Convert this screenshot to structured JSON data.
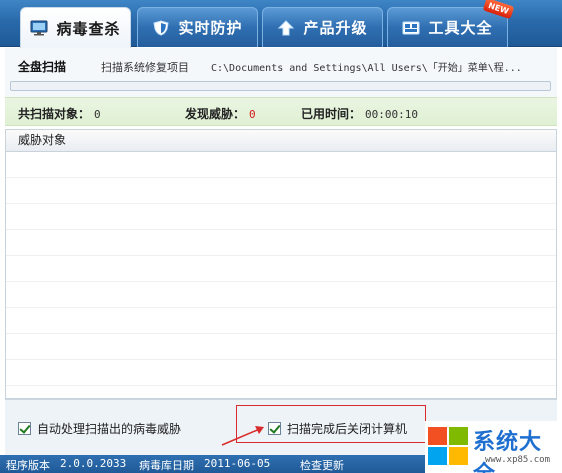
{
  "tabs": [
    {
      "label": "病毒查杀",
      "icon": "monitor-icon",
      "active": true
    },
    {
      "label": "实时防护",
      "icon": "shield-icon",
      "active": false
    },
    {
      "label": "产品升级",
      "icon": "upload-arrow-icon",
      "active": false
    },
    {
      "label": "工具大全",
      "icon": "toolbox-icon",
      "active": false,
      "badge": "NEW"
    }
  ],
  "scan": {
    "title": "全盘扫描",
    "item": "扫描系统修复项目",
    "path": "C:\\Documents and Settings\\All Users\\「开始」菜单\\程...",
    "progress": 0.0
  },
  "stats": {
    "scanned_label": "共扫描对象：",
    "scanned_value": "0",
    "threats_label": "发现威胁：",
    "threats_value": "0",
    "time_label": "已用时间：",
    "time_value": "00:00:10"
  },
  "table": {
    "header": "威胁对象",
    "rows": []
  },
  "options": {
    "auto_handle": {
      "label": "自动处理扫描出的病毒威胁",
      "checked": true
    },
    "shutdown": {
      "label": "扫描完成后关闭计算机",
      "checked": true
    }
  },
  "status": {
    "version_label": "程序版本",
    "version": "2.0.0.2033",
    "db_label": "病毒库日期",
    "db_date": "2011-06-05",
    "update": "检查更新"
  },
  "watermark": {
    "text": "系统大全",
    "url": "www.xp85.com"
  },
  "colors": {
    "tabbar": "#2a6aab",
    "threat_count": "#d41b1b",
    "highlight": "#d92b2b"
  }
}
